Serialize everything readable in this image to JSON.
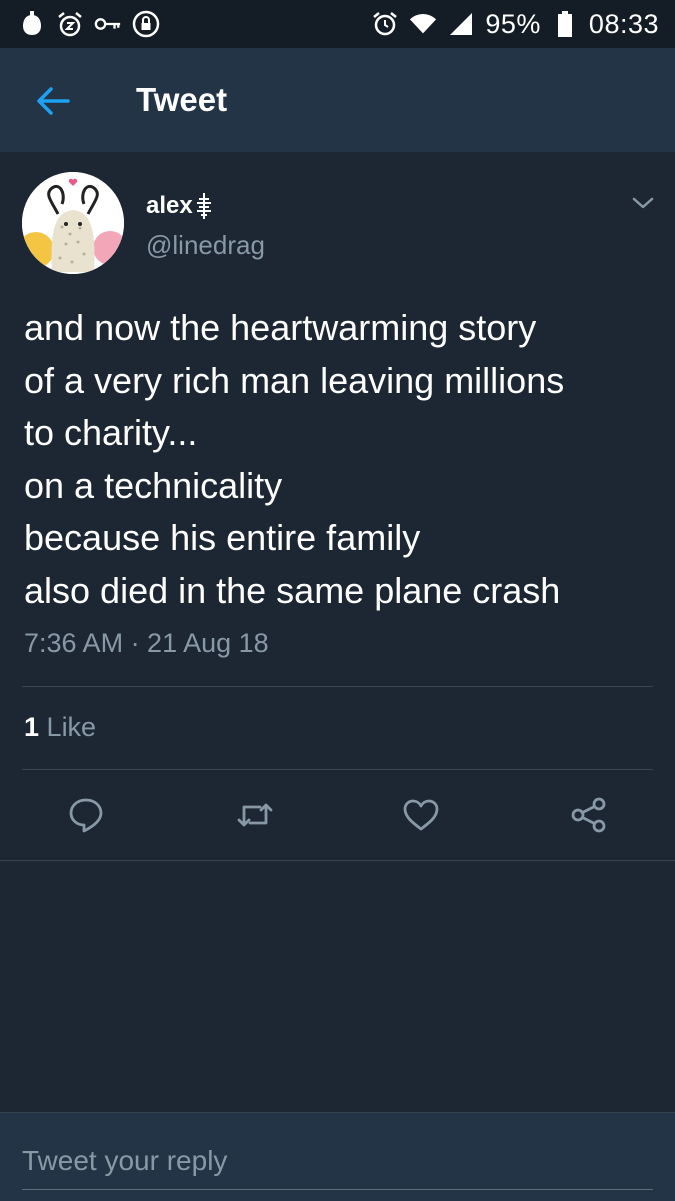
{
  "status_bar": {
    "icons_left": [
      "battery-saver-icon",
      "alarm-snooze-icon",
      "vpn-key-icon",
      "lock-circle-icon"
    ],
    "icons_right": [
      "alarm-icon",
      "wifi-icon",
      "signal-icon",
      "battery-icon"
    ],
    "battery": "95%",
    "time": "08:33"
  },
  "header": {
    "title": "Tweet",
    "back_icon": "arrow-left-icon"
  },
  "tweet": {
    "author_name": "alex",
    "author_handle": "@linedrag",
    "text_lines": [
      "and now the heartwarming story",
      "of a very rich man leaving millions",
      "to charity...",
      "on a technicality",
      "because his entire family",
      "also died in the same plane crash"
    ],
    "timestamp": "7:36 AM · 21 Aug 18",
    "likes_count": "1",
    "likes_label": "Like"
  },
  "actions": [
    "reply-icon",
    "retweet-icon",
    "like-icon",
    "share-icon"
  ],
  "reply": {
    "placeholder": "Tweet your reply"
  },
  "colors": {
    "background": "#1c2733",
    "header": "#243447",
    "status_bar": "#141d26",
    "accent": "#1da1f2",
    "secondary_text": "#8899a6",
    "divider": "#38444d"
  }
}
